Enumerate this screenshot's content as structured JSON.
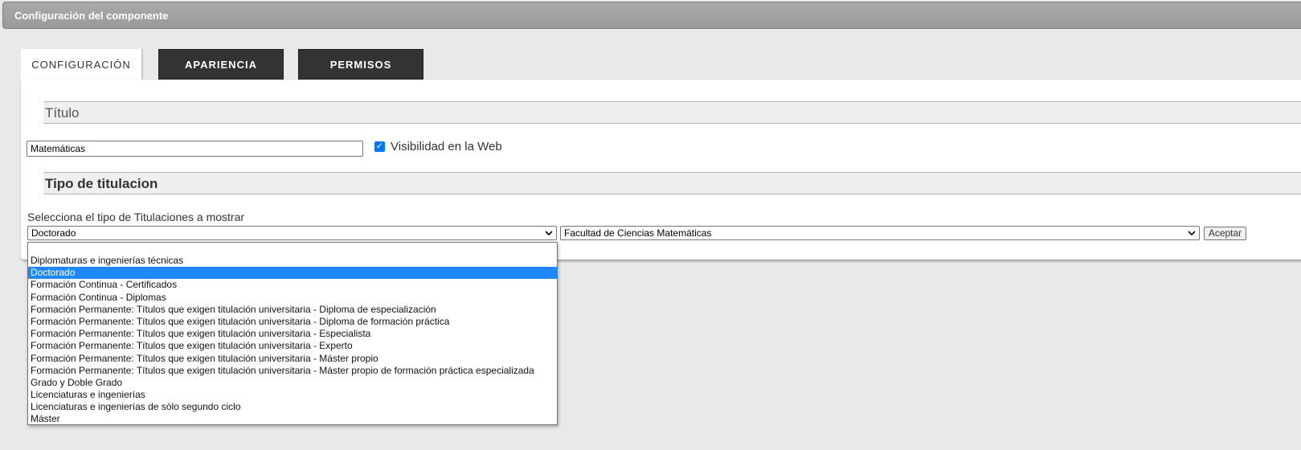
{
  "window": {
    "title": "Configuración del componente"
  },
  "tabs": [
    {
      "label": "CONFIGURACIÓN",
      "active": true
    },
    {
      "label": "APARIENCIA",
      "active": false
    },
    {
      "label": "PERMISOS",
      "active": false
    }
  ],
  "title_section": {
    "heading": "Título",
    "input_value": "Matemáticas",
    "visibility_checked": true,
    "visibility_label": "Visibilidad en la Web"
  },
  "type_section": {
    "heading": "Tipo de titulacion",
    "select_label": "Selecciona el tipo de Titulaciones a mostrar",
    "type_selected": "Doctorado",
    "faculty_selected": "Facultad de Ciencias Matemáticas",
    "accept_label": "Aceptar"
  },
  "dropdown": {
    "selected_index": 1,
    "options": [
      "Diplomaturas e ingenierías técnicas",
      "Doctorado",
      "Formación Continua - Certificados",
      "Formación Continua - Diplomas",
      "Formación Permanente: Títulos que exigen titulación universitaria - Diploma de especialización",
      "Formación Permanente: Títulos que exigen titulación universitaria - Diploma de formación práctica",
      "Formación Permanente: Títulos que exigen titulación universitaria - Especialista",
      "Formación Permanente: Títulos que exigen titulación universitaria - Experto",
      "Formación Permanente: Títulos que exigen titulación universitaria - Máster propio",
      "Formación Permanente: Títulos que exigen titulación universitaria - Máster propio de formación práctica especializada",
      "Grado y Doble Grado",
      "Licenciaturas e ingenierías",
      "Licenciaturas e ingenierías de sólo segundo ciclo",
      "Máster"
    ]
  },
  "colors": {
    "accent": "#1e88ff",
    "tab_dark": "#333333",
    "titlebar": "#a3a3a3"
  }
}
